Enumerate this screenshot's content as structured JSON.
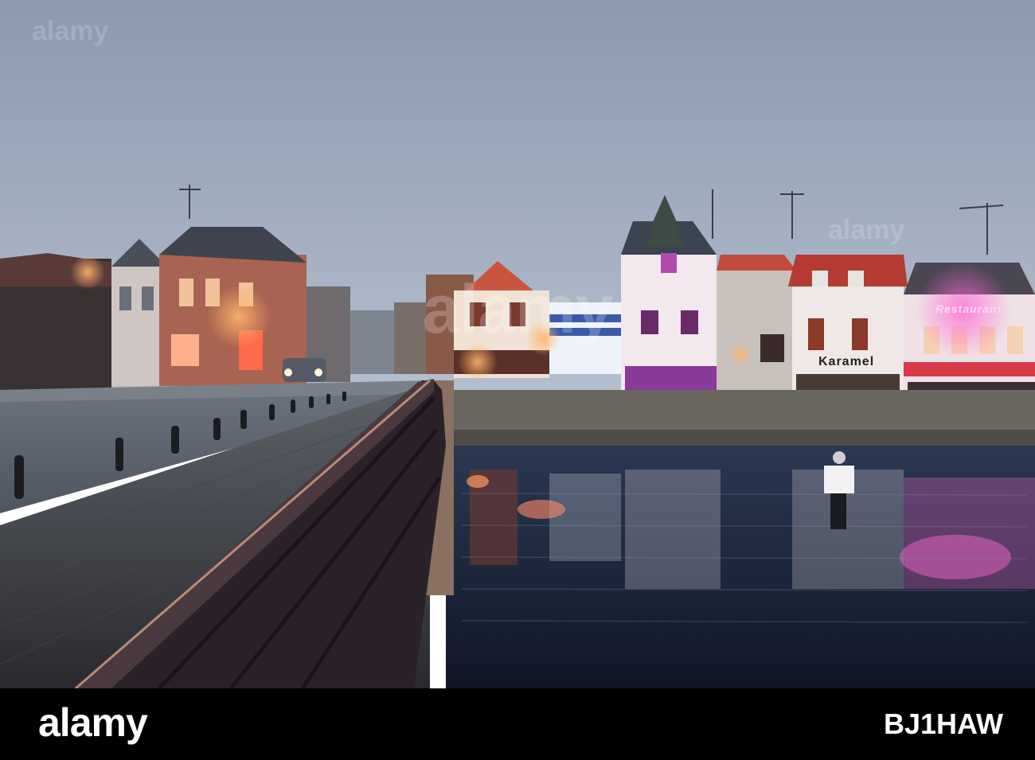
{
  "photo": {
    "shop_sign": "Karamel",
    "restaurant_sign": "Restaurant",
    "watermark": "alamy",
    "colors": {
      "sky_top": "#8e9cb0",
      "sky_bottom": "#b7c2d1",
      "water": "#1e2a40",
      "neon_red": "#ff3b3b",
      "neon_pink": "#ff6ad5",
      "lamp_glow": "#ffb46a"
    }
  },
  "footer": {
    "brand": "alamy",
    "image_id": "BJ1HAW"
  }
}
